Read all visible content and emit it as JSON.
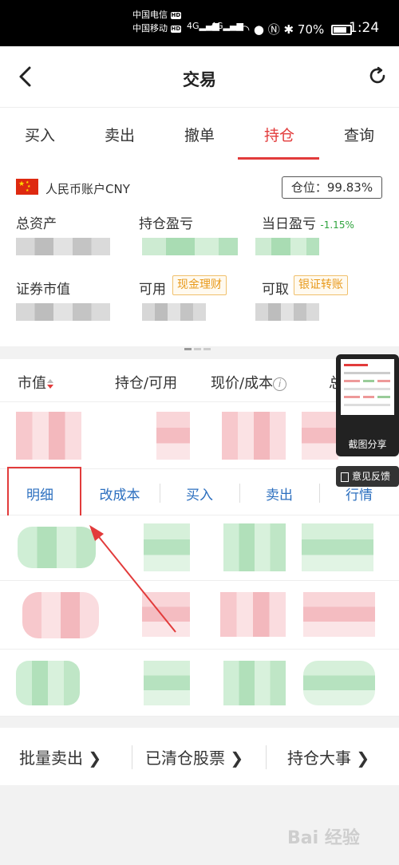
{
  "status_bar": {
    "carrier1": "中国电信",
    "carrier2": "中国移动",
    "hd": "HD",
    "net1": "4G",
    "net2": "4G",
    "battery": "70%",
    "time": "1:24"
  },
  "nav": {
    "title": "交易"
  },
  "tabs": [
    {
      "label": "买入"
    },
    {
      "label": "卖出"
    },
    {
      "label": "撤单"
    },
    {
      "label": "持仓"
    },
    {
      "label": "查询"
    }
  ],
  "active_tab": 3,
  "account": {
    "label": "人民币账户CNY",
    "position": "仓位：99.83%",
    "total_assets": "总资产",
    "holding_pnl": "持仓盈亏",
    "daily_pnl": "当日盈亏",
    "daily_pnl_pct": "-1.15%",
    "market_value": "证券市值",
    "available": "可用",
    "cash_wealth": "现金理财",
    "withdrawable": "可取",
    "bank_transfer": "银证转账"
  },
  "list_header": {
    "market_value": "市值",
    "holding_available": "持仓/可用",
    "price_cost": "现价/成本",
    "info_glyph": "i",
    "total": "总"
  },
  "row_actions": [
    {
      "label": "明细"
    },
    {
      "label": "改成本"
    },
    {
      "label": "买入"
    },
    {
      "label": "卖出"
    },
    {
      "label": "行情"
    }
  ],
  "bottom_links": [
    {
      "label": "批量卖出 ❯"
    },
    {
      "label": "已清仓股票 ❯"
    },
    {
      "label": "持仓大事 ❯"
    }
  ],
  "float": {
    "screenshot_share": "截图分享",
    "feedback": "意见反馈"
  },
  "watermark": "Bai 经验",
  "colors": {
    "accent_red": "#e23b3b",
    "link_blue": "#2c6fbf",
    "gain_green": "#2ea43d",
    "tag_orange": "#e89a1c"
  }
}
